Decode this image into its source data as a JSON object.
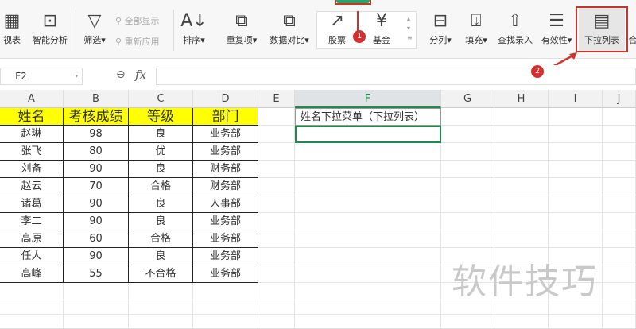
{
  "ribbon": {
    "pivot": "视表",
    "smart": "智能分析",
    "filter": "筛选",
    "show_all": "全部显示",
    "reapply": "重新应用",
    "sort": "排序",
    "dup": "重复项",
    "compare": "数据对比",
    "stock": "股票",
    "fund": "基金",
    "split": "分列",
    "fill": "填充",
    "lookup": "查找录入",
    "validity": "有效性",
    "dropdown": "下拉列表",
    "more": "合"
  },
  "annotations": {
    "step1": "1",
    "step2": "2"
  },
  "formula": {
    "name_box": "F2",
    "fx": "fx",
    "value": ""
  },
  "columns": [
    "A",
    "B",
    "C",
    "D",
    "E",
    "F",
    "G",
    "H",
    "I",
    "J"
  ],
  "table": {
    "headers": [
      "姓名",
      "考核成绩",
      "等级",
      "部门"
    ],
    "rows": [
      [
        "赵琳",
        "98",
        "良",
        "业务部"
      ],
      [
        "张飞",
        "80",
        "优",
        "业务部"
      ],
      [
        "刘备",
        "90",
        "良",
        "财务部"
      ],
      [
        "赵云",
        "70",
        "合格",
        "财务部"
      ],
      [
        "诸葛",
        "90",
        "良",
        "人事部"
      ],
      [
        "李二",
        "90",
        "良",
        "业务部"
      ],
      [
        "高原",
        "60",
        "合格",
        "业务部"
      ],
      [
        "任人",
        "90",
        "良",
        "业务部"
      ],
      [
        "高峰",
        "55",
        "不合格",
        "业务部"
      ]
    ]
  },
  "f1": "姓名下拉菜单（下拉列表）",
  "watermark": "软件技巧"
}
